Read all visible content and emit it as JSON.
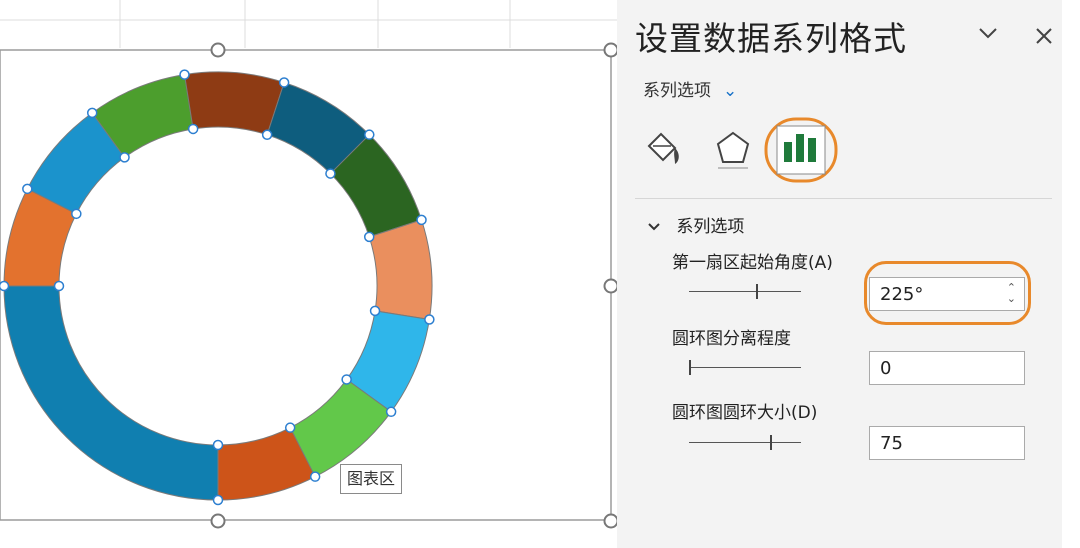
{
  "chart_data": {
    "type": "donut",
    "start_angle_deg": 225,
    "series": [
      {
        "color": "#2b6521"
      },
      {
        "color": "#ea8f5e"
      },
      {
        "color": "#2fb6ea"
      },
      {
        "color": "#62c84a"
      },
      {
        "color": "#cd5419"
      },
      {
        "color": "#107fb0"
      },
      {
        "color": "#e3722e"
      },
      {
        "color": "#1b93cc"
      },
      {
        "color": "#4c9e2d"
      },
      {
        "color": "#8e3b14"
      },
      {
        "color": "#0e5d7e"
      }
    ],
    "values": [
      6,
      6,
      6,
      6,
      6,
      20,
      6,
      6,
      6,
      6,
      6
    ]
  },
  "tooltip": "图表区",
  "panel": {
    "title": "设置数据系列格式",
    "dropdown_label": "系列选项",
    "dropdown_chevron": "⌄",
    "minimize_icon": "chevron-down-icon",
    "close_icon": "close-icon",
    "tabs": [
      "fill-line-icon",
      "effects-pentagon-icon",
      "series-options-bar-icon"
    ],
    "section_header": "系列选项",
    "fields": [
      {
        "label": "第一扇区起始角度(A)",
        "value": "225°",
        "slider_fraction": 0.62
      },
      {
        "label": "圆环图分离程度",
        "value": "0",
        "slider_fraction": 0.0
      },
      {
        "label": "圆环图圆环大小(D)",
        "value": "75",
        "slider_fraction": 0.75
      }
    ],
    "accent_color": "#e8892b"
  }
}
